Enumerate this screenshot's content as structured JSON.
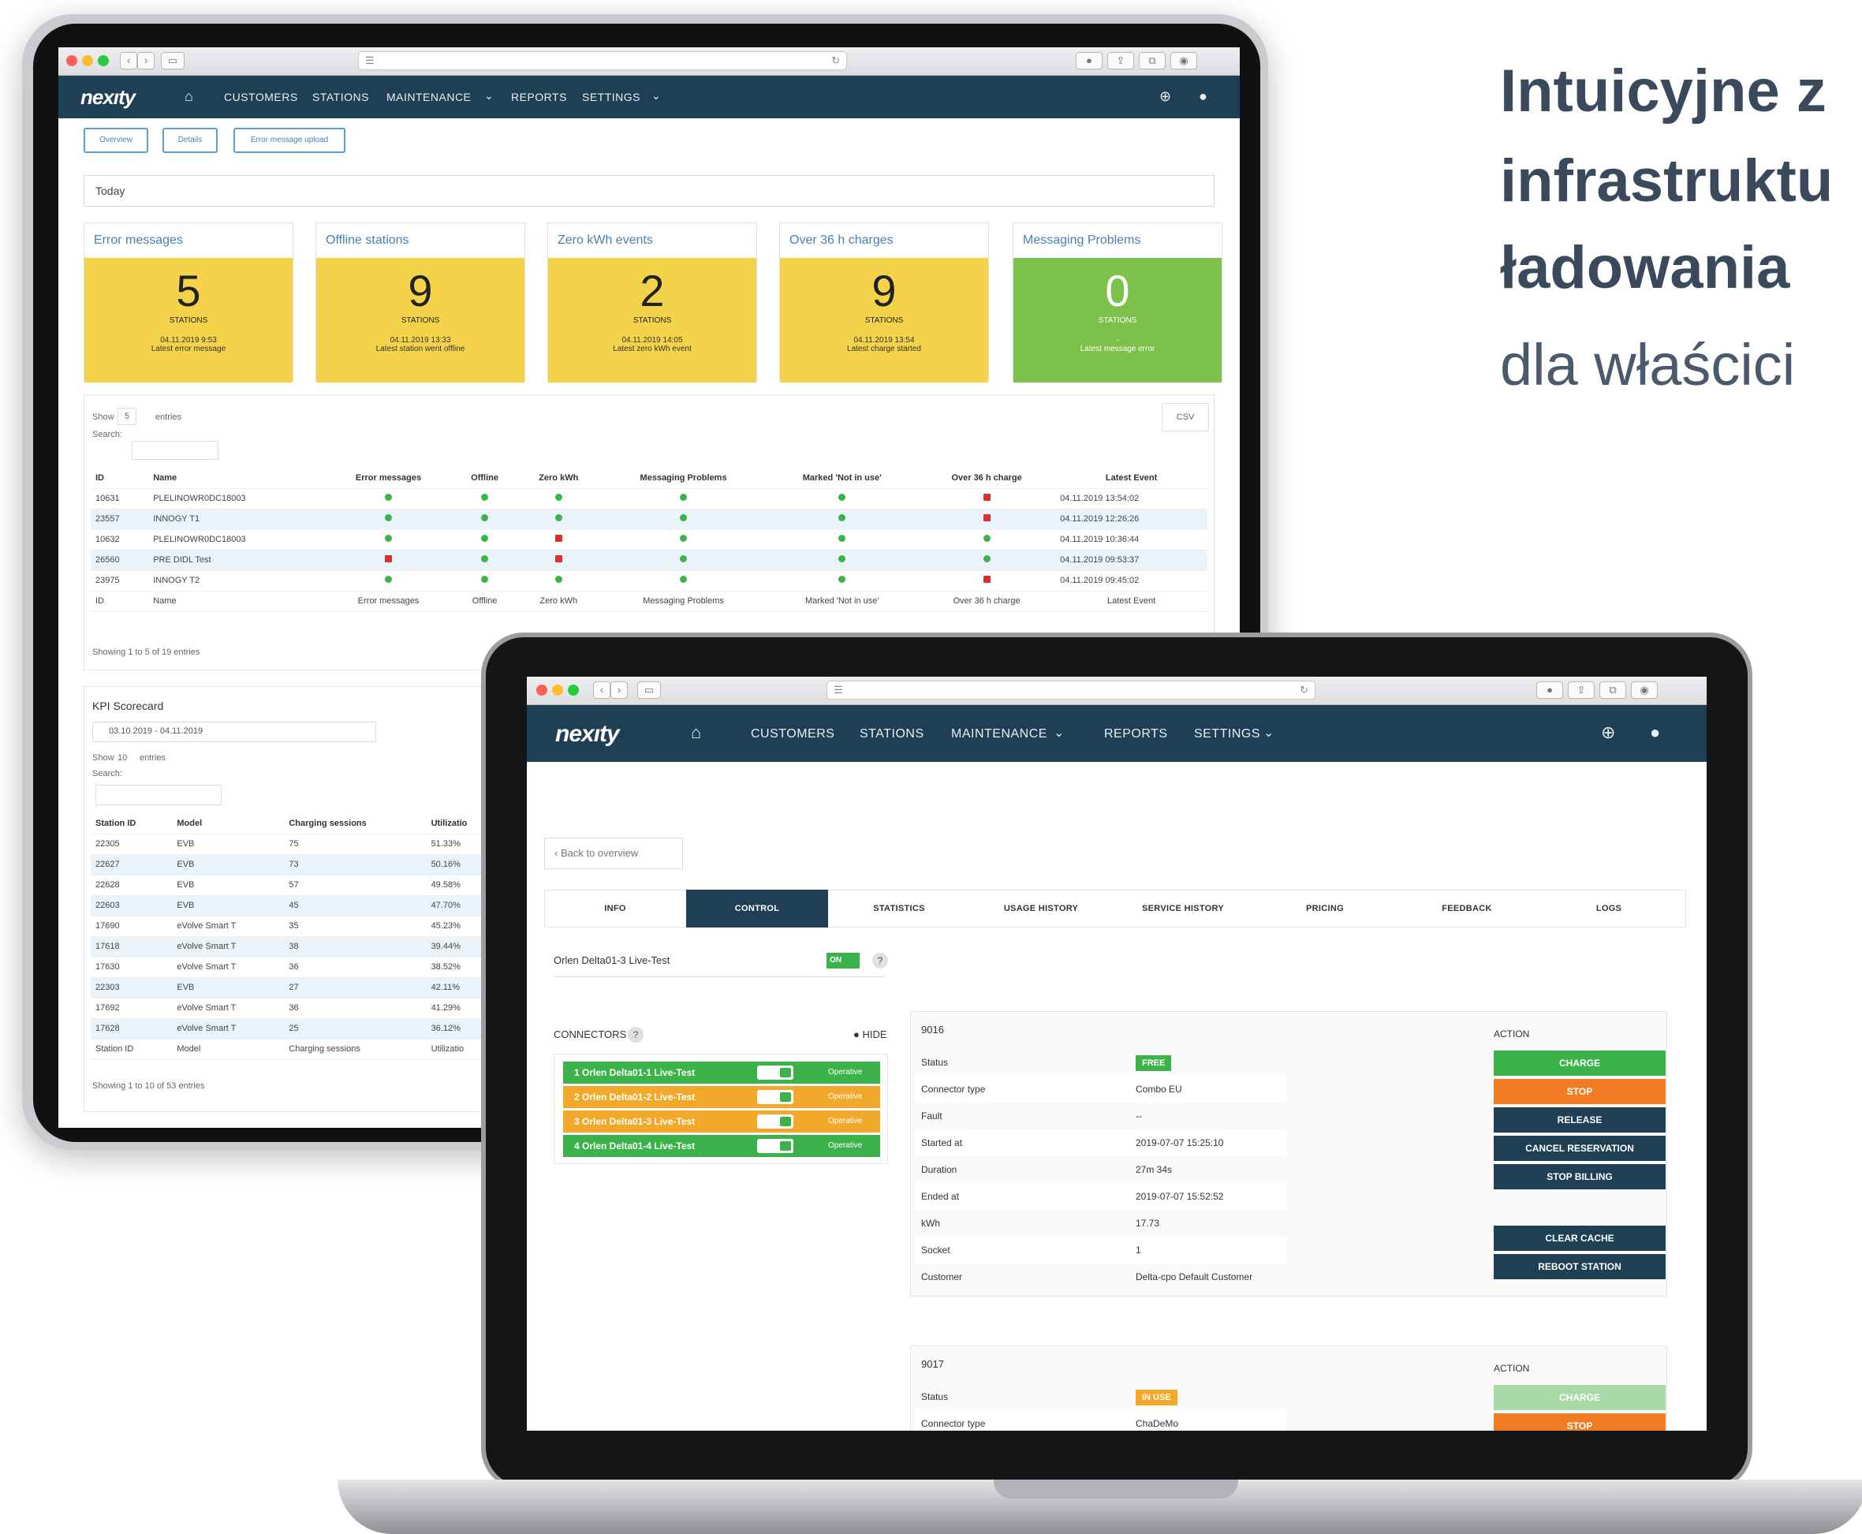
{
  "marketing": {
    "line1": "Intuicyjne z",
    "line2": "infrastruktu",
    "line3": "ładowania",
    "subtitle": "dla właścici"
  },
  "tablet": {
    "nav": {
      "logo": "nexıty",
      "items": [
        "CUSTOMERS",
        "STATIONS",
        "MAINTENANCE",
        "REPORTS",
        "SETTINGS"
      ]
    },
    "subnav": [
      "Overview",
      "Details",
      "Error message upload"
    ],
    "period": "Today",
    "cards": [
      {
        "title": "Error messages",
        "value": "5",
        "unit": "STATIONS",
        "date": "04.11.2019 9:53",
        "caption": "Latest error message",
        "color": "#f4d34a"
      },
      {
        "title": "Offline stations",
        "value": "9",
        "unit": "STATIONS",
        "date": "04.11.2019 13:33",
        "caption": "Latest station went offline",
        "color": "#f4d34a"
      },
      {
        "title": "Zero kWh events",
        "value": "2",
        "unit": "STATIONS",
        "date": "04.11.2019 14:05",
        "caption": "Latest zero kWh event",
        "color": "#f4d34a"
      },
      {
        "title": "Over 36 h charges",
        "value": "9",
        "unit": "STATIONS",
        "date": "04.11.2019 13:54",
        "caption": "Latest charge started",
        "color": "#f4d34a"
      },
      {
        "title": "Messaging Problems",
        "value": "0",
        "unit": "STATIONS",
        "date": "-",
        "caption": "Latest message error",
        "color": "#7cc24a"
      }
    ],
    "table": {
      "show": "Show",
      "show_value": "5",
      "entries": "entries",
      "search": "Search:",
      "csv": "CSV",
      "headers": [
        "ID",
        "Name",
        "Error messages",
        "Offline",
        "Zero kWh",
        "Messaging Problems",
        "Marked 'Not in use'",
        "Over 36 h charge",
        "Latest Event"
      ],
      "rows": [
        {
          "id": "10631",
          "name": "PLELINOWR0DC18003",
          "s": [
            "g",
            "g",
            "g",
            "g",
            "g",
            "r"
          ],
          "event": "04.11.2019 13:54:02"
        },
        {
          "id": "23557",
          "name": "INNOGY T1",
          "s": [
            "g",
            "g",
            "g",
            "g",
            "g",
            "r"
          ],
          "event": "04.11.2019 12:26:26"
        },
        {
          "id": "10632",
          "name": "PLELINOWR0DC18003",
          "s": [
            "g",
            "g",
            "r",
            "g",
            "g",
            "g"
          ],
          "event": "04.11.2019 10:36:44"
        },
        {
          "id": "26560",
          "name": "PRE DIDL Test",
          "s": [
            "r",
            "g",
            "r",
            "g",
            "g",
            "g"
          ],
          "event": "04.11.2019 09:53:37"
        },
        {
          "id": "23975",
          "name": "INNOGY T2",
          "s": [
            "g",
            "g",
            "g",
            "g",
            "g",
            "r"
          ],
          "event": "04.11.2019 09:45:02"
        }
      ],
      "footer": [
        "ID",
        "Name",
        "Error messages",
        "Offline",
        "Zero kWh",
        "Messaging Problems",
        "Marked 'Not in use'",
        "Over 36 h charge",
        "Latest Event"
      ],
      "showing": "Showing 1 to 5 of 19 entries"
    },
    "kpi": {
      "title": "KPI Scorecard",
      "range": "03.10.2019 - 04.11.2019",
      "show": "Show",
      "show_value": "10",
      "entries": "entries",
      "search": "Search:",
      "headers": [
        "Station ID",
        "Model",
        "Charging sessions",
        "Utilizatio"
      ],
      "rows": [
        [
          "22305",
          "EVB",
          "75",
          "51.33%"
        ],
        [
          "22627",
          "EVB",
          "73",
          "50.16%"
        ],
        [
          "22628",
          "EVB",
          "57",
          "49.58%"
        ],
        [
          "22603",
          "EVB",
          "45",
          "47.70%"
        ],
        [
          "17690",
          "eVolve Smart T",
          "35",
          "45.23%"
        ],
        [
          "17618",
          "eVolve Smart T",
          "38",
          "39.44%"
        ],
        [
          "17630",
          "eVolve Smart T",
          "36",
          "38.52%"
        ],
        [
          "22303",
          "EVB",
          "27",
          "42.11%"
        ],
        [
          "17692",
          "eVolve Smart T",
          "36",
          "41.29%"
        ],
        [
          "17628",
          "eVolve Smart T",
          "25",
          "36.12%"
        ]
      ],
      "footer": [
        "Station ID",
        "Model",
        "Charging sessions",
        "Utilizatio"
      ],
      "showing": "Showing 1 to 10 of 53 entries"
    }
  },
  "laptop": {
    "nav": {
      "logo": "nexıty",
      "items": [
        "CUSTOMERS",
        "STATIONS",
        "MAINTENANCE",
        "REPORTS",
        "SETTINGS"
      ]
    },
    "back": "Back to overview",
    "tabs": [
      "INFO",
      "CONTROL",
      "STATISTICS",
      "USAGE HISTORY",
      "SERVICE HISTORY",
      "PRICING",
      "FEEDBACK",
      "LOGS"
    ],
    "station_name": "Orlen Delta01-3 Live-Test",
    "station_toggle": "ON",
    "connectors_label": "CONNECTORS",
    "hide": "HIDE",
    "connectors": [
      {
        "label": "1  Orlen Delta01-1 Live-Test",
        "status": "Operative",
        "color": "#3cb34a"
      },
      {
        "label": "2  Orlen Delta01-2 Live-Test",
        "status": "Operative",
        "color": "#f2a82b"
      },
      {
        "label": "3  Orlen Delta01-3 Live-Test",
        "status": "Operative",
        "color": "#f2a82b"
      },
      {
        "label": "4  Orlen Delta01-4 Live-Test",
        "status": "Operative",
        "color": "#3cb34a"
      }
    ],
    "panel1": {
      "id": "9016",
      "action_label": "ACTION",
      "rows": [
        {
          "k": "Status",
          "v": "FREE"
        },
        {
          "k": "Connector type",
          "v": "Combo EU"
        },
        {
          "k": "Fault",
          "v": "--"
        },
        {
          "k": "Started at",
          "v": "2019-07-07 15:25:10"
        },
        {
          "k": "Duration",
          "v": "27m 34s"
        },
        {
          "k": "Ended at",
          "v": "2019-07-07 15:52:52"
        },
        {
          "k": "kWh",
          "v": "17.73"
        },
        {
          "k": "Socket",
          "v": "1"
        },
        {
          "k": "Customer",
          "v": "Delta-cpo Default Customer"
        }
      ],
      "buttons": [
        "CHARGE",
        "STOP",
        "RELEASE",
        "CANCEL RESERVATION",
        "STOP BILLING",
        "CLEAR CACHE",
        "REBOOT STATION"
      ]
    },
    "panel2": {
      "id": "9017",
      "action_label": "ACTION",
      "rows": [
        {
          "k": "Status",
          "v": "IN USE"
        },
        {
          "k": "Connector type",
          "v": "ChaDeMo"
        }
      ],
      "buttons": [
        "CHARGE",
        "STOP"
      ]
    }
  }
}
